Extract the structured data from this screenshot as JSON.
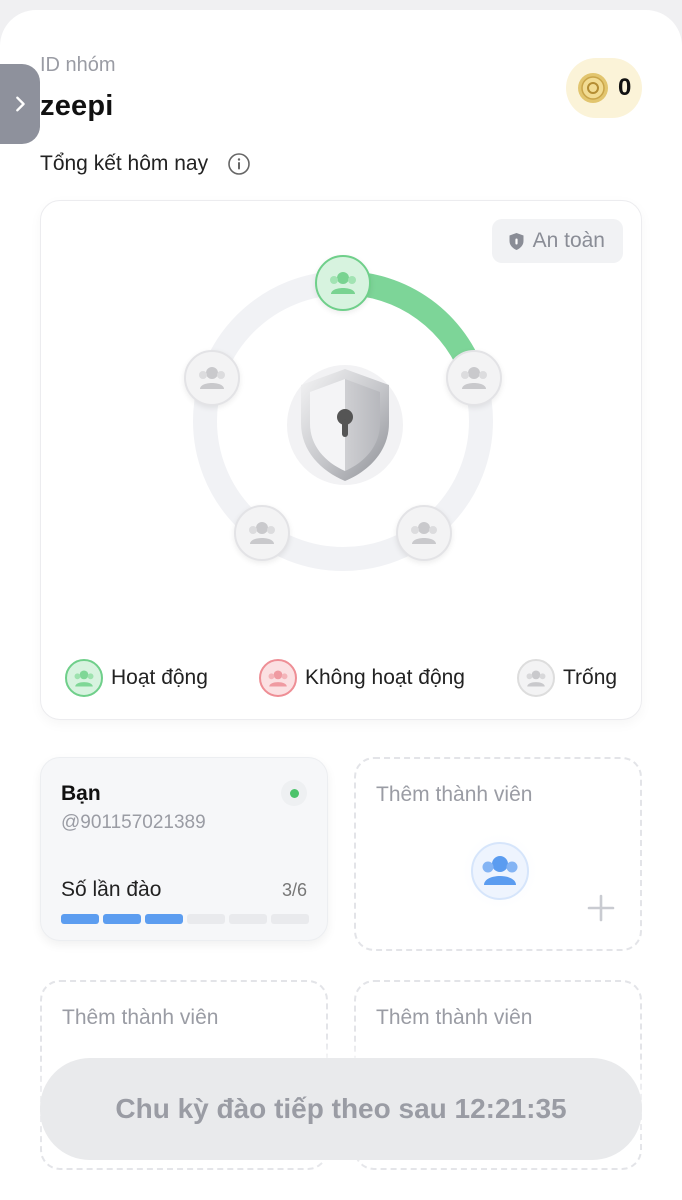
{
  "header": {
    "group_label": "ID nhóm",
    "group_name": "zeepi",
    "coin_count": "0"
  },
  "summary": {
    "title": "Tổng kết hôm nay",
    "safety_badge": "An toàn",
    "members_active_fraction": 0.2,
    "legend": {
      "active": "Hoạt động",
      "inactive": "Không hoạt động",
      "empty": "Trống"
    }
  },
  "member": {
    "name": "Bạn",
    "handle": "@901157021389",
    "mine_label": "Số lần đào",
    "mine_count": "3/6",
    "mine_done": 3,
    "mine_total": 6
  },
  "slots": {
    "add_label_1": "Thêm thành viên",
    "add_label_2": "Thêm thành viên",
    "add_label_3": "Thêm thành viên"
  },
  "footer": {
    "cycle_text": "Chu kỳ đào tiếp theo sau 12:21:35"
  },
  "colors": {
    "active": "#4cc36b",
    "inactive": "#ee8e95",
    "progress": "#5c9df0"
  },
  "icons": {
    "side_tab": "chevron-right-icon",
    "coin": "coin-icon",
    "info": "info-icon",
    "badge": "shield-icon",
    "center": "shield-lock-icon",
    "member": "users-icon",
    "add": "plus-icon"
  }
}
